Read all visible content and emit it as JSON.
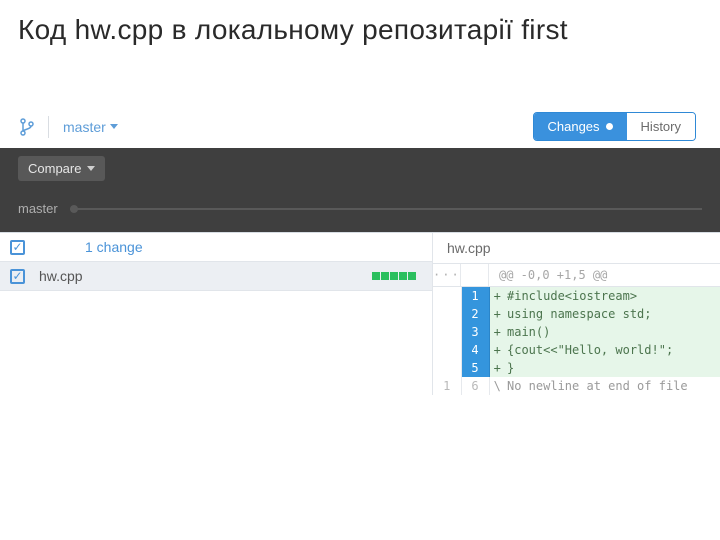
{
  "slide": {
    "title": "Код hw.cpp в локальному репозитарії first"
  },
  "toolbar": {
    "branch": "master",
    "tabs": {
      "changes": "Changes",
      "history": "History"
    }
  },
  "darkbar": {
    "compare": "Compare",
    "branch_label": "master"
  },
  "left": {
    "summary": "1 change",
    "file": "hw.cpp"
  },
  "diff": {
    "file_header": "hw.cpp",
    "hunk_dots": "···",
    "hunk_info": "@@ -0,0 +1,5 @@",
    "lines": [
      {
        "old": "",
        "new": "1",
        "sign": "+",
        "text": "#include<iostream>",
        "type": "add"
      },
      {
        "old": "",
        "new": "2",
        "sign": "+",
        "text": "using namespace std;",
        "type": "add"
      },
      {
        "old": "",
        "new": "3",
        "sign": "+",
        "text": "main()",
        "type": "add"
      },
      {
        "old": "",
        "new": "4",
        "sign": "+",
        "text": "{cout<<\"Hello, world!\";",
        "type": "add"
      },
      {
        "old": "",
        "new": "5",
        "sign": "+",
        "text": "}",
        "type": "add"
      },
      {
        "old": "1",
        "new": "6",
        "sign": "\\",
        "text": "No newline at end of file",
        "type": "meta"
      }
    ]
  }
}
